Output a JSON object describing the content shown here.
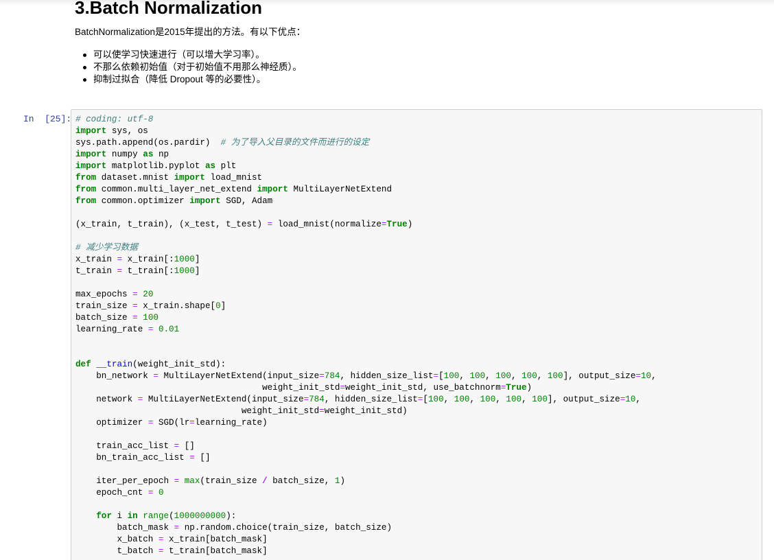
{
  "markdown": {
    "heading": "3.Batch Normalization",
    "paragraph": "BatchNormalization是2015年提出的方法。有以下优点：",
    "bullets": [
      "可以使学习快速进行（可以增大学习率）。",
      "不那么依赖初始值（对于初始值不用那么神经质）。",
      "抑制过拟合（降低 Dropout 等的必要性）。"
    ]
  },
  "code_cell": {
    "prompt": "In  [25]:",
    "lines": [
      [
        [
          "# coding: utf-8",
          "cm"
        ]
      ],
      [
        [
          "import",
          "kw"
        ],
        [
          " sys, os",
          "plain"
        ]
      ],
      [
        [
          "sys.path.append(os.pardir)  ",
          "plain"
        ],
        [
          "# 为了导入父目录的文件而进行的设定",
          "cm"
        ]
      ],
      [
        [
          "import",
          "kw"
        ],
        [
          " numpy ",
          "plain"
        ],
        [
          "as",
          "kw"
        ],
        [
          " np",
          "plain"
        ]
      ],
      [
        [
          "import",
          "kw"
        ],
        [
          " matplotlib.pyplot ",
          "plain"
        ],
        [
          "as",
          "kw"
        ],
        [
          " plt",
          "plain"
        ]
      ],
      [
        [
          "from",
          "kw"
        ],
        [
          " dataset.mnist ",
          "plain"
        ],
        [
          "import",
          "kw"
        ],
        [
          " load_mnist",
          "plain"
        ]
      ],
      [
        [
          "from",
          "kw"
        ],
        [
          " common.multi_layer_net_extend ",
          "plain"
        ],
        [
          "import",
          "kw"
        ],
        [
          " MultiLayerNetExtend",
          "plain"
        ]
      ],
      [
        [
          "from",
          "kw"
        ],
        [
          " common.optimizer ",
          "plain"
        ],
        [
          "import",
          "kw"
        ],
        [
          " SGD, Adam",
          "plain"
        ]
      ],
      [],
      [
        [
          "(x_train, t_train), (x_test, t_test) ",
          "plain"
        ],
        [
          "=",
          "op"
        ],
        [
          " load_mnist(normalize",
          "plain"
        ],
        [
          "=",
          "op"
        ],
        [
          "True",
          "kw"
        ],
        [
          ")",
          "plain"
        ]
      ],
      [],
      [
        [
          "# 减少学习数据",
          "cm"
        ]
      ],
      [
        [
          "x_train ",
          "plain"
        ],
        [
          "=",
          "op"
        ],
        [
          " x_train[:",
          "plain"
        ],
        [
          "1000",
          "nm"
        ],
        [
          "]",
          "plain"
        ]
      ],
      [
        [
          "t_train ",
          "plain"
        ],
        [
          "=",
          "op"
        ],
        [
          " t_train[:",
          "plain"
        ],
        [
          "1000",
          "nm"
        ],
        [
          "]",
          "plain"
        ]
      ],
      [],
      [
        [
          "max_epochs ",
          "plain"
        ],
        [
          "=",
          "op"
        ],
        [
          " ",
          "plain"
        ],
        [
          "20",
          "nm"
        ]
      ],
      [
        [
          "train_size ",
          "plain"
        ],
        [
          "=",
          "op"
        ],
        [
          " x_train.shape[",
          "plain"
        ],
        [
          "0",
          "nm"
        ],
        [
          "]",
          "plain"
        ]
      ],
      [
        [
          "batch_size ",
          "plain"
        ],
        [
          "=",
          "op"
        ],
        [
          " ",
          "plain"
        ],
        [
          "100",
          "nm"
        ]
      ],
      [
        [
          "learning_rate ",
          "plain"
        ],
        [
          "=",
          "op"
        ],
        [
          " ",
          "plain"
        ],
        [
          "0.01",
          "nm"
        ]
      ],
      [],
      [],
      [
        [
          "def",
          "kw"
        ],
        [
          " ",
          "plain"
        ],
        [
          "__train",
          "def"
        ],
        [
          "(weight_init_std):",
          "plain"
        ]
      ],
      [
        [
          "    bn_network ",
          "plain"
        ],
        [
          "=",
          "op"
        ],
        [
          " MultiLayerNetExtend(input_size",
          "plain"
        ],
        [
          "=",
          "op"
        ],
        [
          "784",
          "nm"
        ],
        [
          ", hidden_size_list",
          "plain"
        ],
        [
          "=",
          "op"
        ],
        [
          "[",
          "plain"
        ],
        [
          "100",
          "nm"
        ],
        [
          ", ",
          "plain"
        ],
        [
          "100",
          "nm"
        ],
        [
          ", ",
          "plain"
        ],
        [
          "100",
          "nm"
        ],
        [
          ", ",
          "plain"
        ],
        [
          "100",
          "nm"
        ],
        [
          ", ",
          "plain"
        ],
        [
          "100",
          "nm"
        ],
        [
          "], output_size",
          "plain"
        ],
        [
          "=",
          "op"
        ],
        [
          "10",
          "nm"
        ],
        [
          ",",
          "plain"
        ]
      ],
      [
        [
          "                                    weight_init_std",
          "plain"
        ],
        [
          "=",
          "op"
        ],
        [
          "weight_init_std, use_batchnorm",
          "plain"
        ],
        [
          "=",
          "op"
        ],
        [
          "True",
          "kw"
        ],
        [
          ")",
          "plain"
        ]
      ],
      [
        [
          "    network ",
          "plain"
        ],
        [
          "=",
          "op"
        ],
        [
          " MultiLayerNetExtend(input_size",
          "plain"
        ],
        [
          "=",
          "op"
        ],
        [
          "784",
          "nm"
        ],
        [
          ", hidden_size_list",
          "plain"
        ],
        [
          "=",
          "op"
        ],
        [
          "[",
          "plain"
        ],
        [
          "100",
          "nm"
        ],
        [
          ", ",
          "plain"
        ],
        [
          "100",
          "nm"
        ],
        [
          ", ",
          "plain"
        ],
        [
          "100",
          "nm"
        ],
        [
          ", ",
          "plain"
        ],
        [
          "100",
          "nm"
        ],
        [
          ", ",
          "plain"
        ],
        [
          "100",
          "nm"
        ],
        [
          "], output_size",
          "plain"
        ],
        [
          "=",
          "op"
        ],
        [
          "10",
          "nm"
        ],
        [
          ",",
          "plain"
        ]
      ],
      [
        [
          "                                weight_init_std",
          "plain"
        ],
        [
          "=",
          "op"
        ],
        [
          "weight_init_std)",
          "plain"
        ]
      ],
      [
        [
          "    optimizer ",
          "plain"
        ],
        [
          "=",
          "op"
        ],
        [
          " SGD(lr",
          "plain"
        ],
        [
          "=",
          "op"
        ],
        [
          "learning_rate)",
          "plain"
        ]
      ],
      [],
      [
        [
          "    train_acc_list ",
          "plain"
        ],
        [
          "=",
          "op"
        ],
        [
          " []",
          "plain"
        ]
      ],
      [
        [
          "    bn_train_acc_list ",
          "plain"
        ],
        [
          "=",
          "op"
        ],
        [
          " []",
          "plain"
        ]
      ],
      [],
      [
        [
          "    iter_per_epoch ",
          "plain"
        ],
        [
          "=",
          "op"
        ],
        [
          " ",
          "plain"
        ],
        [
          "max",
          "bi"
        ],
        [
          "(train_size ",
          "plain"
        ],
        [
          "/",
          "opb"
        ],
        [
          " batch_size, ",
          "plain"
        ],
        [
          "1",
          "nm"
        ],
        [
          ")",
          "plain"
        ]
      ],
      [
        [
          "    epoch_cnt ",
          "plain"
        ],
        [
          "=",
          "op"
        ],
        [
          " ",
          "plain"
        ],
        [
          "0",
          "nm"
        ]
      ],
      [],
      [
        [
          "    ",
          "plain"
        ],
        [
          "for",
          "kw"
        ],
        [
          " i ",
          "plain"
        ],
        [
          "in",
          "kw"
        ],
        [
          " ",
          "plain"
        ],
        [
          "range",
          "bi"
        ],
        [
          "(",
          "plain"
        ],
        [
          "1000000000",
          "nm"
        ],
        [
          "):",
          "plain"
        ]
      ],
      [
        [
          "        batch_mask ",
          "plain"
        ],
        [
          "=",
          "op"
        ],
        [
          " np.random.choice(train_size, batch_size)",
          "plain"
        ]
      ],
      [
        [
          "        x_batch ",
          "plain"
        ],
        [
          "=",
          "op"
        ],
        [
          " x_train[batch_mask]",
          "plain"
        ]
      ],
      [
        [
          "        t_batch ",
          "plain"
        ],
        [
          "=",
          "op"
        ],
        [
          " t_train[batch_mask]",
          "plain"
        ]
      ]
    ]
  }
}
